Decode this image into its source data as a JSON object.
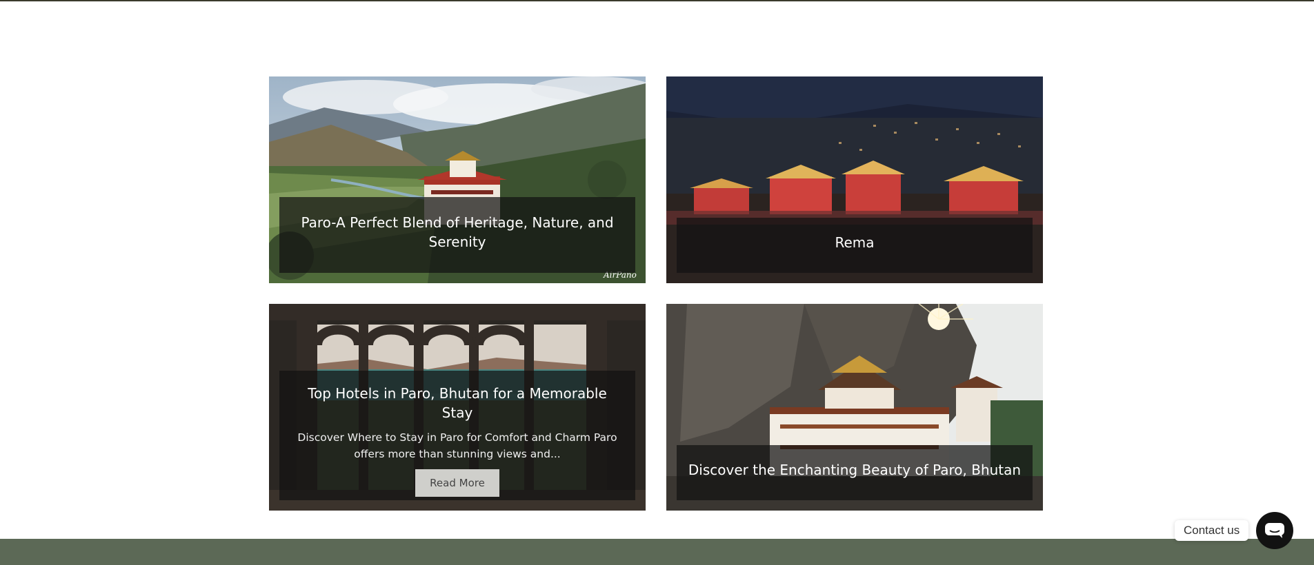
{
  "cards": [
    {
      "title": "Paro-A Perfect Blend of Heritage, Nature, and Serenity",
      "watermark": "AirPano",
      "image": "paro-valley-dzong-photo"
    },
    {
      "title": "Rema",
      "image": "dzong-at-night-photo"
    },
    {
      "title": "Top Hotels in Paro, Bhutan for a Memorable Stay",
      "description": "Discover Where to Stay in Paro for Comfort and Charm Paro offers more than stunning views and...",
      "button": "Read More",
      "image": "hotel-window-mountain-view-photo"
    },
    {
      "title": "Discover the Enchanting Beauty of Paro, Bhutan",
      "image": "tigers-nest-monastery-photo"
    }
  ],
  "contact": {
    "label": "Contact us",
    "icon": "chat-bubble-icon"
  },
  "colors": {
    "footer": "#5c6956",
    "overlay": "rgba(18,18,18,0.72)",
    "contact_button": "#121212"
  }
}
